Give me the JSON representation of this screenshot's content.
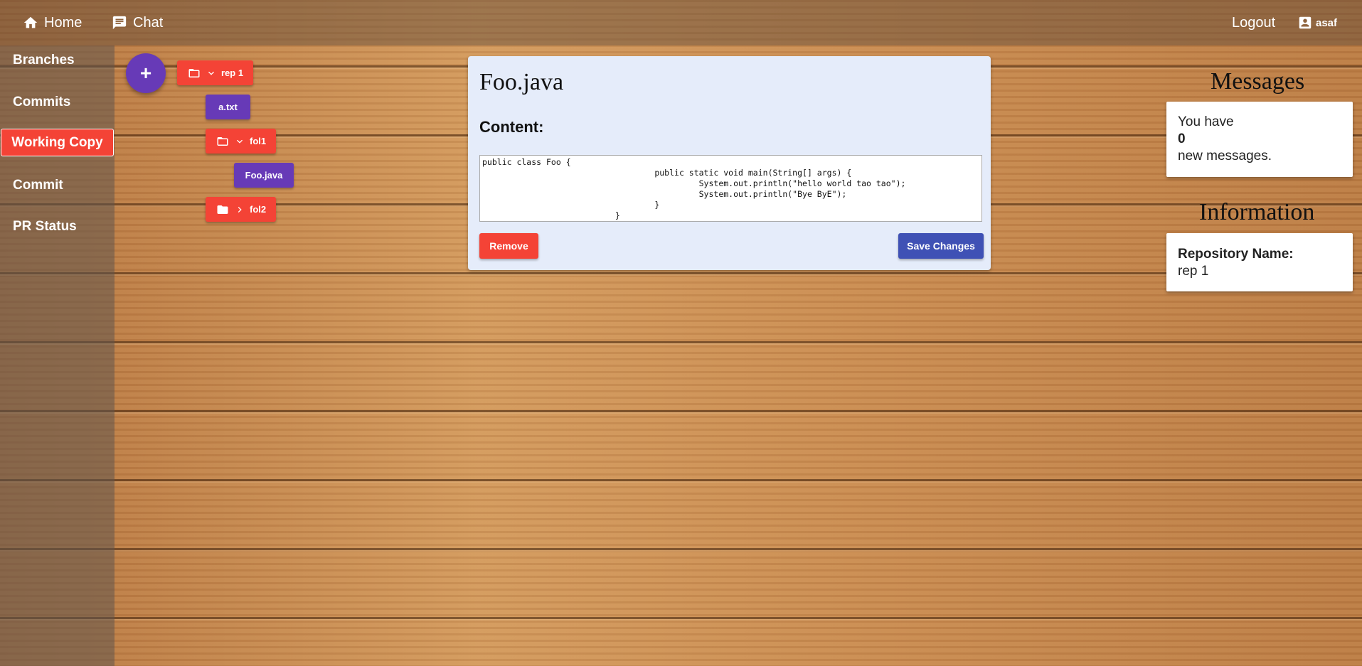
{
  "topbar": {
    "home": {
      "label": "Home",
      "icon": "home-icon"
    },
    "chat": {
      "label": "Chat",
      "icon": "chat-icon"
    },
    "logout": "Logout",
    "user": {
      "name": "asaf",
      "icon": "account-icon"
    }
  },
  "sidebar": {
    "items": [
      {
        "label": "Branches"
      },
      {
        "label": "Commits"
      },
      {
        "label": "Working Copy",
        "active": true
      },
      {
        "label": "Commit"
      },
      {
        "label": "PR Status"
      }
    ]
  },
  "tree": {
    "add_label": "+",
    "nodes": [
      {
        "label": "rep 1",
        "type": "folder",
        "expanded": true
      },
      {
        "label": "a.txt",
        "type": "file"
      },
      {
        "label": "fol1",
        "type": "folder",
        "expanded": true
      },
      {
        "label": "Foo.java",
        "type": "file"
      },
      {
        "label": "fol2",
        "type": "folder",
        "expanded": false
      }
    ]
  },
  "editor": {
    "title": "Foo.java",
    "content_label": "Content:",
    "content": "public class Foo {\n                                   public static void main(String[] args) {\n                                            System.out.println(\"hello world tao tao\");\n                                            System.out.println(\"Bye ByE\");\n                                   }\n                           }",
    "remove_label": "Remove",
    "save_label": "Save Changes"
  },
  "messages": {
    "title": "Messages",
    "line1": "You have",
    "count": "0",
    "line2": "new messages."
  },
  "information": {
    "title": "Information",
    "repo_label": "Repository Name:",
    "repo_value": "rep 1"
  },
  "colors": {
    "accent_red": "#f44336",
    "accent_purple": "#673ab7",
    "accent_indigo": "#3f51b5"
  }
}
